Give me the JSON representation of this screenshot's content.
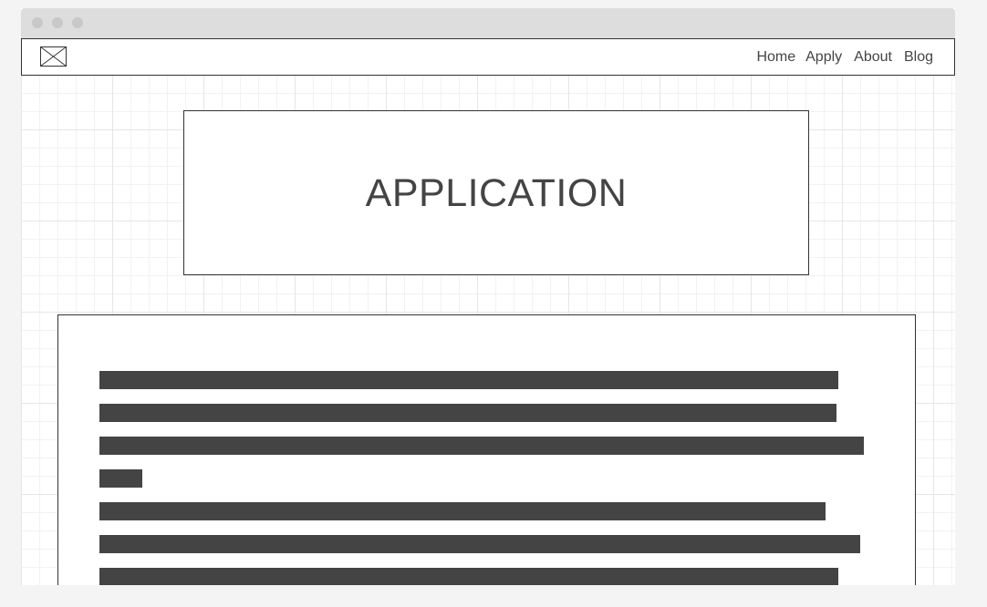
{
  "window": {
    "controls": [
      "close",
      "minimize",
      "maximize"
    ]
  },
  "navbar": {
    "logo_icon": "image-placeholder-icon",
    "links": [
      {
        "label": "Home"
      },
      {
        "label": "Apply"
      },
      {
        "label": "About"
      },
      {
        "label": "Blog"
      }
    ]
  },
  "hero": {
    "title": "APPLICATION"
  },
  "content": {
    "placeholder_text_lines": 7
  },
  "colors": {
    "page_background": "#f4f4f4",
    "titlebar": "#dddddd",
    "window_dots": "#c8c8c8",
    "border": "#333333",
    "text": "#444444",
    "placeholder_bar": "#444444",
    "grid_line": "#e6e6e6"
  }
}
